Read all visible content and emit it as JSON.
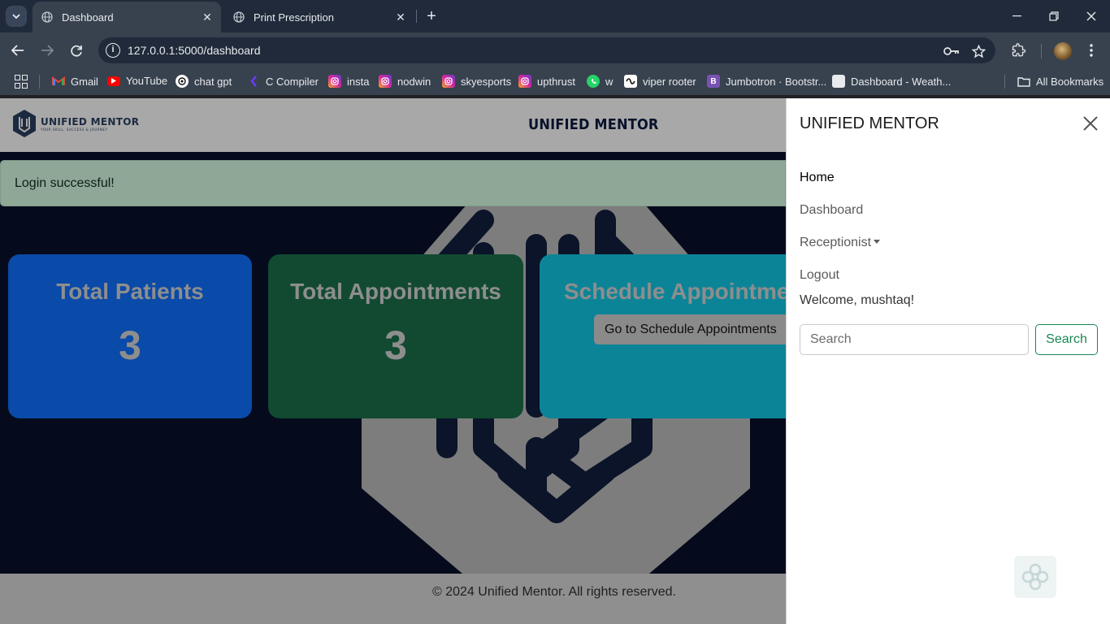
{
  "browser": {
    "tabs": [
      {
        "title": "Dashboard",
        "active": true
      },
      {
        "title": "Print Prescription",
        "active": false
      }
    ],
    "address": {
      "host": "127.0.0.1",
      "path": ":5000/dashboard"
    },
    "bookmarks": [
      {
        "label": "Gmail",
        "icon": "gmail-icon"
      },
      {
        "label": "YouTube",
        "icon": "youtube-icon"
      },
      {
        "label": "chat gpt",
        "icon": "chatgpt-icon"
      },
      {
        "label": "C Compiler",
        "icon": "compiler-icon"
      },
      {
        "label": "insta",
        "icon": "instagram-icon"
      },
      {
        "label": "nodwin",
        "icon": "instagram-icon"
      },
      {
        "label": "skyesports",
        "icon": "instagram-icon"
      },
      {
        "label": "upthrust",
        "icon": "instagram-icon"
      },
      {
        "label": "w",
        "icon": "whatsapp-icon"
      },
      {
        "label": "viper rooter",
        "icon": "viper-icon"
      },
      {
        "label": "Jumbotron · Bootstr...",
        "icon": "bootstrap-icon"
      },
      {
        "label": "Dashboard - Weath...",
        "icon": "page-icon"
      },
      {
        "label": "All Bookmarks",
        "icon": "folder-icon"
      }
    ],
    "colors": {
      "instagram": "#d6249f",
      "youtube": "#ff0000",
      "whatsapp": "#25d366",
      "bootstrap": "#7952b3"
    }
  },
  "site": {
    "logo_text": "UNIFIED MENTOR",
    "logo_tagline": "YOUR SKILL, SUCCESS & JOURNEY",
    "header_title": "UNIFIED MENTOR",
    "alert": "Login successful!",
    "cards": {
      "patients": {
        "title": "Total Patients",
        "value": "3"
      },
      "appointments": {
        "title": "Total Appointments",
        "value": "3"
      },
      "schedule": {
        "title": "Schedule Appointments",
        "button": "Go to Schedule Appointments"
      }
    },
    "footer": "© 2024 Unified Mentor. All rights reserved.",
    "colors": {
      "card_patients": "#0a4aa8",
      "card_appointments": "#124a31",
      "card_schedule": "#0c8497",
      "search_green": "#198754"
    }
  },
  "offcanvas": {
    "title": "UNIFIED MENTOR",
    "nav": {
      "home": "Home",
      "dashboard": "Dashboard",
      "receptionist": "Receptionist",
      "logout": "Logout"
    },
    "welcome": "Welcome, mushtaq!",
    "search_placeholder": "Search",
    "search_button": "Search"
  }
}
